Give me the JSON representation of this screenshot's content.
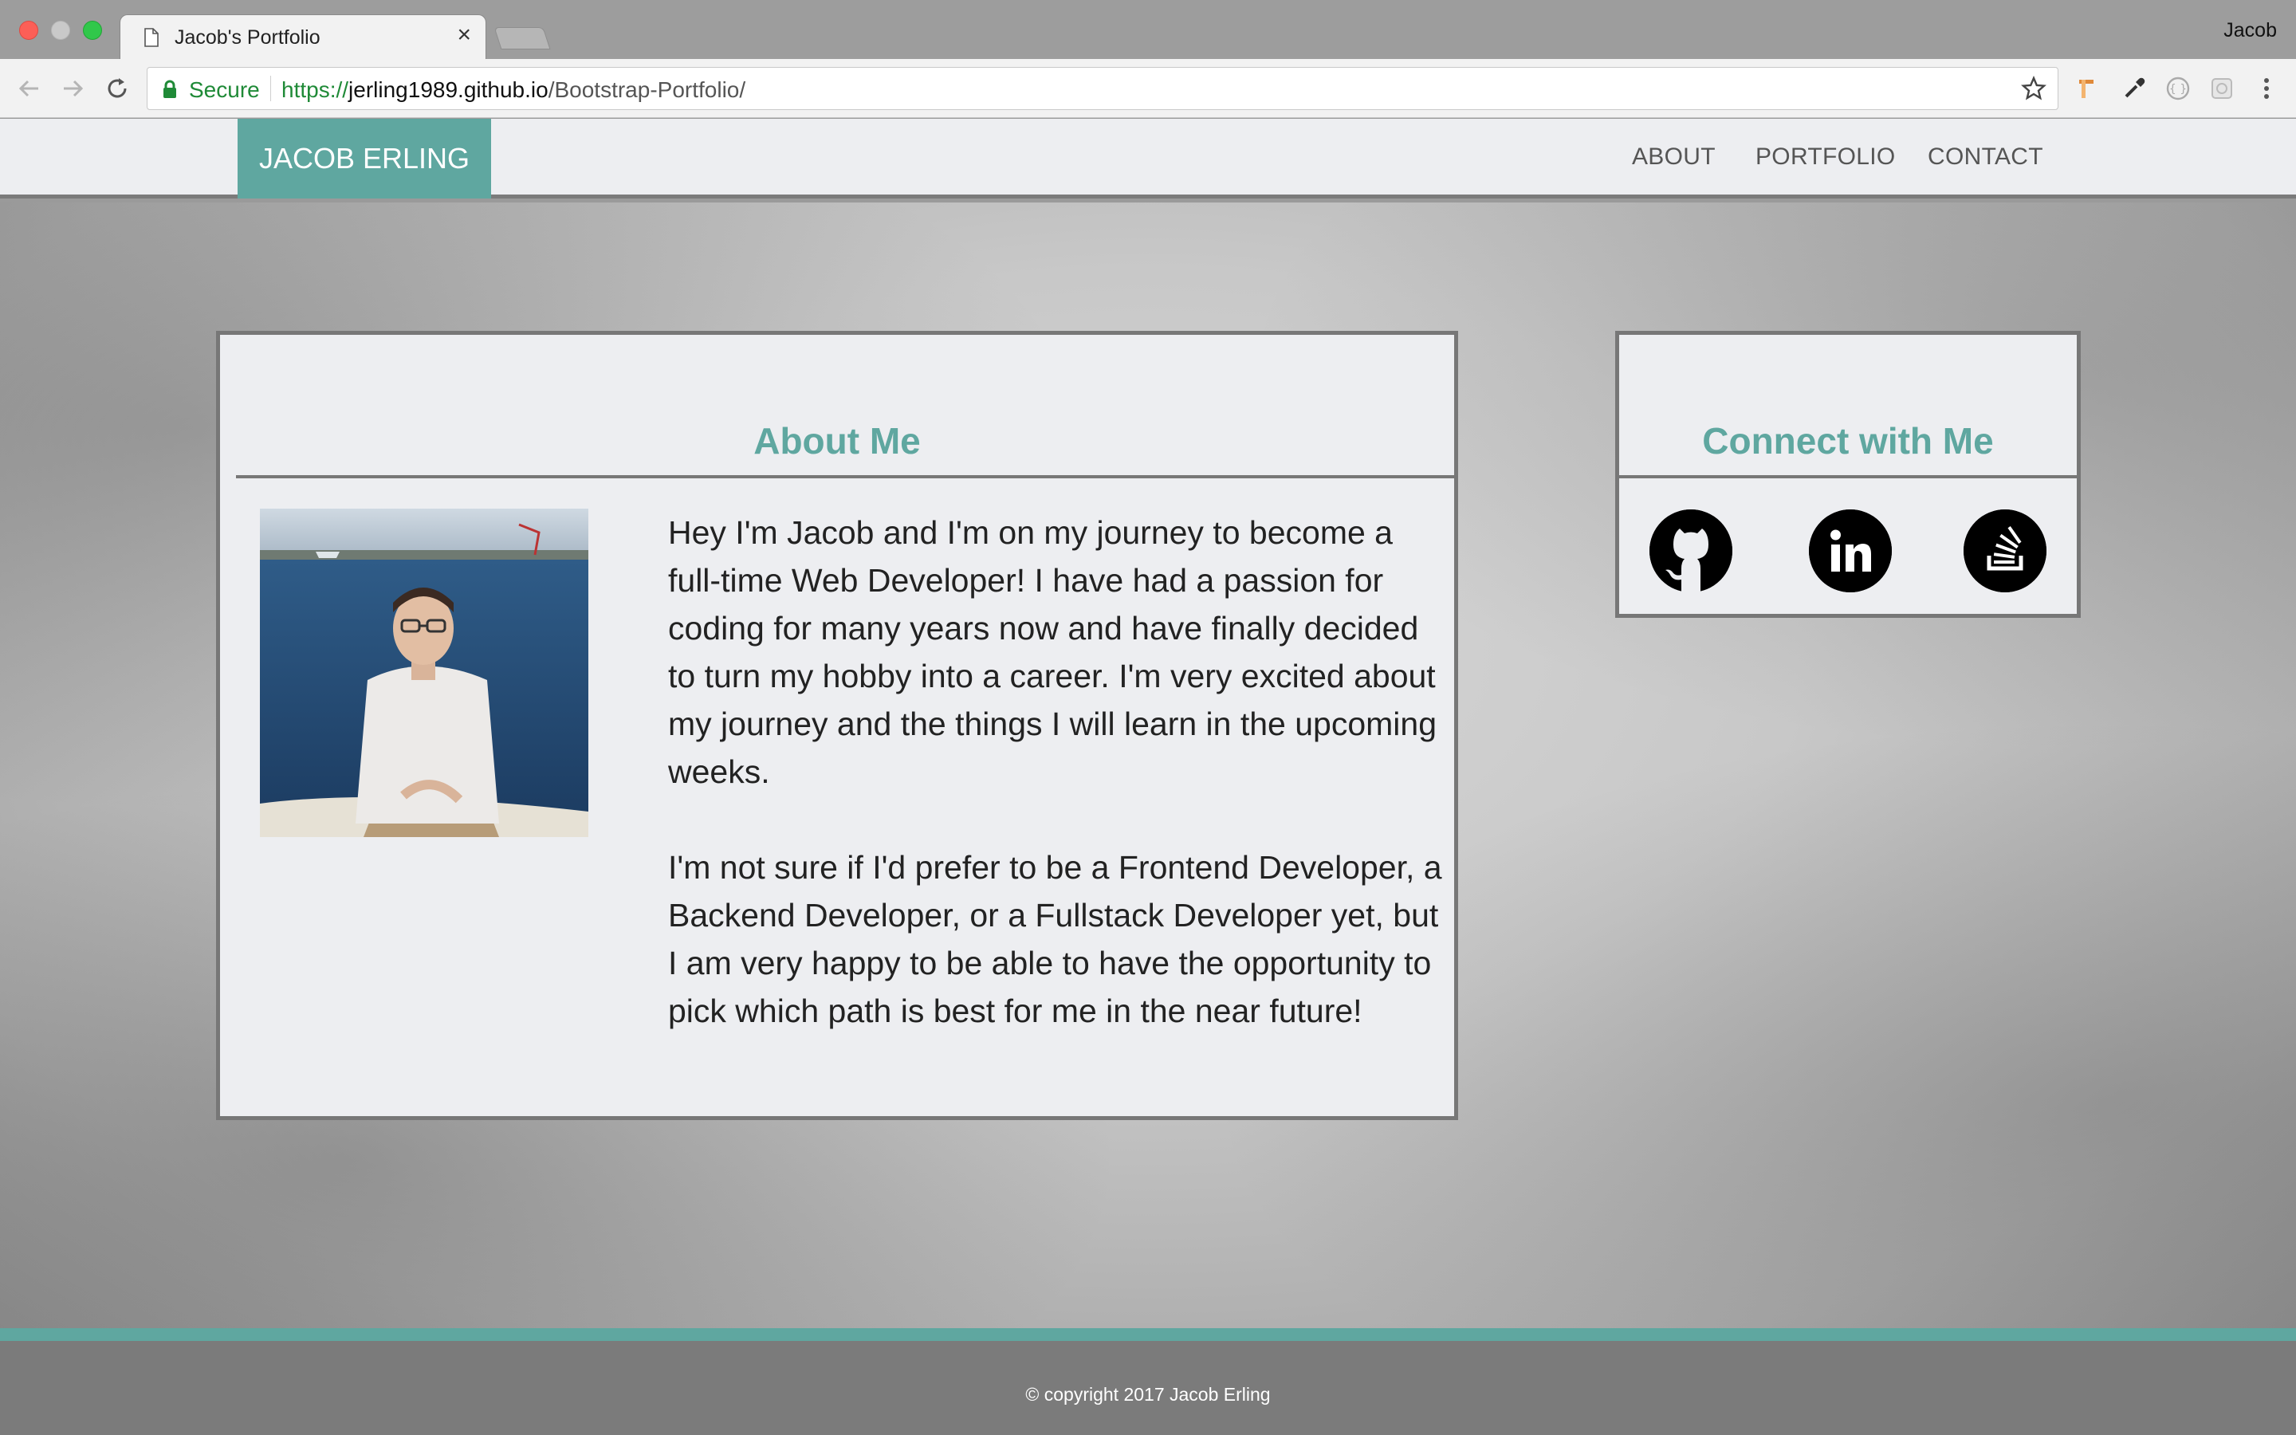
{
  "browser": {
    "tab_title": "Jacob's Portfolio",
    "tab_close": "×",
    "profile_name": "Jacob",
    "secure_label": "Secure",
    "url_scheme": "https://",
    "url_host": "jerling1989.github.io",
    "url_path": "/Bootstrap-Portfolio/"
  },
  "nav": {
    "brand": "JACOB ERLING",
    "links": [
      "ABOUT",
      "PORTFOLIO",
      "CONTACT"
    ]
  },
  "about": {
    "heading": "About Me",
    "paragraphs": [
      "Hey I'm Jacob and I'm on my journey to become a full-time Web Developer! I have had a passion for coding for many years now and have finally decided to turn my hobby into a career. I'm very excited about my journey and the things I will learn in the upcoming weeks.",
      "I'm not sure if I'd prefer to be a Frontend Developer, a Backend Developer, or a Fullstack Developer yet, but I am very happy to be able to have the opportunity to pick which path is best for me in the near future!"
    ]
  },
  "connect": {
    "heading": "Connect with Me",
    "icons": [
      "github-icon",
      "linkedin-icon",
      "stack-overflow-icon"
    ]
  },
  "footer": {
    "copyright": "© copyright 2017 Jacob Erling"
  },
  "colors": {
    "accent": "#5fa7a0",
    "panel_bg": "#edeef1",
    "border": "#777777",
    "footer_bg": "#7b7b7b"
  }
}
